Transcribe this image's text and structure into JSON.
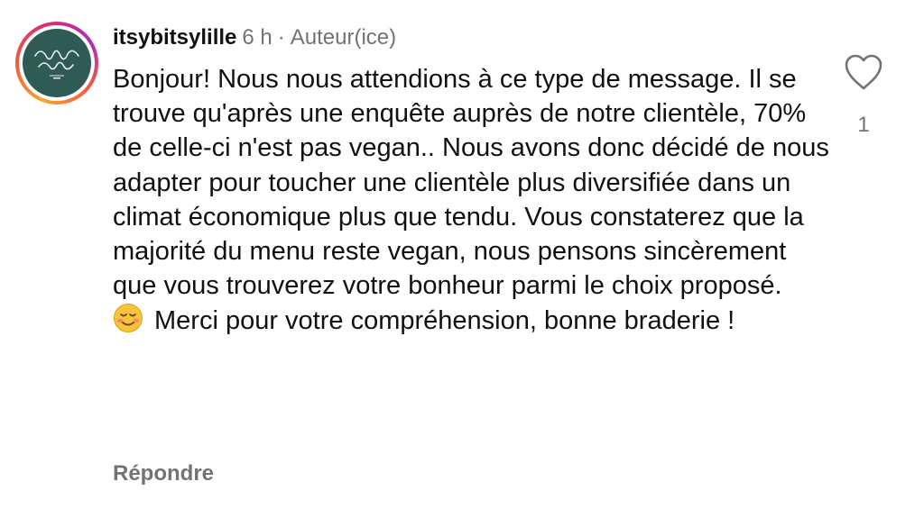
{
  "comment": {
    "username": "itsybitsylille",
    "time": "6 h",
    "separator": "·",
    "author_label": "Auteur(ice)",
    "avatar_logo_text": "itsy bitsy LILLE",
    "text_main": "Bonjour! Nous nous attendions à ce type de message. Il se trouve qu'après une enquête auprès de notre clientèle, 70% de celle-ci n'est pas vegan.. Nous avons donc décidé de nous adapter pour toucher une clientèle plus diversifiée dans un climat économique plus que tendu. Vous constaterez que la majorité du menu reste vegan, nous pensons sincèrement que vous trouverez votre bonheur parmi le choix proposé.",
    "text_end": "Merci pour votre compréhension, bonne braderie !",
    "emoji_icon": "smiling-face-icon",
    "reply_label": "Répondre",
    "like_icon": "heart-outline-icon",
    "like_count": "1"
  },
  "colors": {
    "avatar_bg": "#2f5b57",
    "ring_gradient": [
      "#f7a531",
      "#f4583c",
      "#d62f73",
      "#b52ab7"
    ],
    "secondary_text": "#737373",
    "primary_text": "#111111"
  }
}
